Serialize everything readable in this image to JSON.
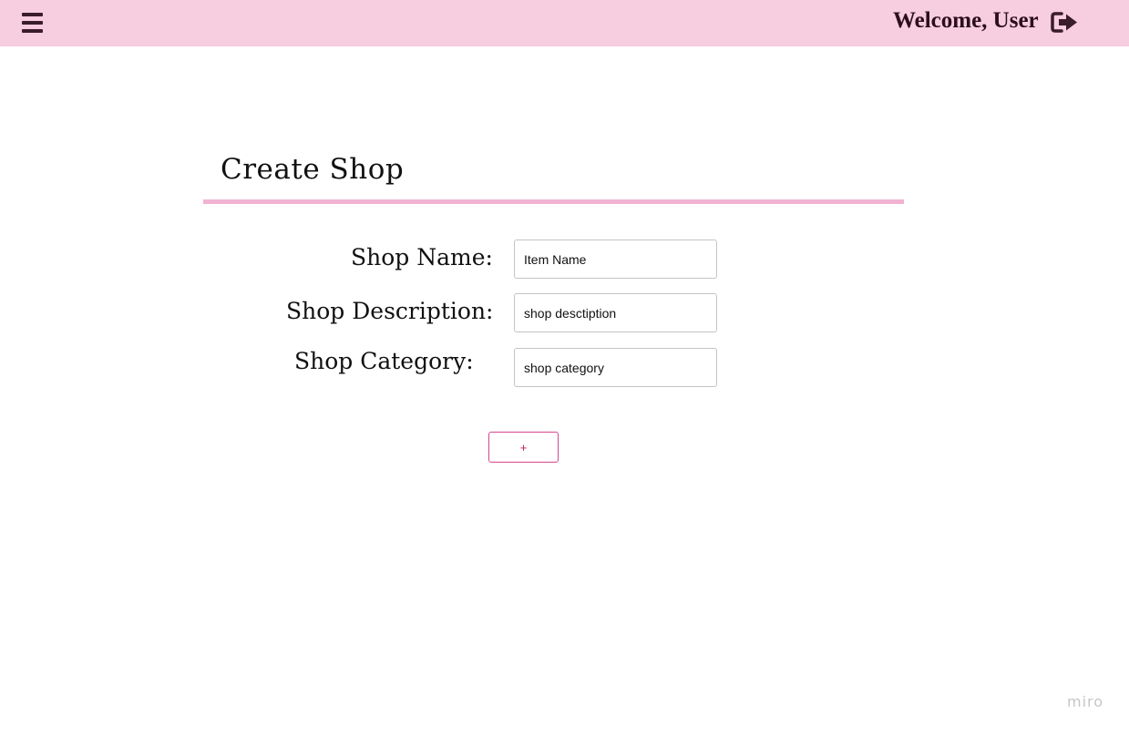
{
  "header": {
    "menu_icon": "hamburger-menu-icon",
    "welcome_text": "Welcome, User",
    "logout_icon": "sign-out-icon",
    "background_color": "#f7cde0"
  },
  "form": {
    "title": "Create Shop",
    "accent_color": "#f2b2d2",
    "fields": [
      {
        "label": "Shop Name:",
        "value": "Item Name"
      },
      {
        "label": "Shop Description:",
        "value": "shop desctiption"
      },
      {
        "label": "Shop Category:",
        "value": "shop category"
      }
    ],
    "submit_label": "+",
    "submit_color": "#d6468e"
  },
  "watermark": {
    "text": "miro"
  }
}
